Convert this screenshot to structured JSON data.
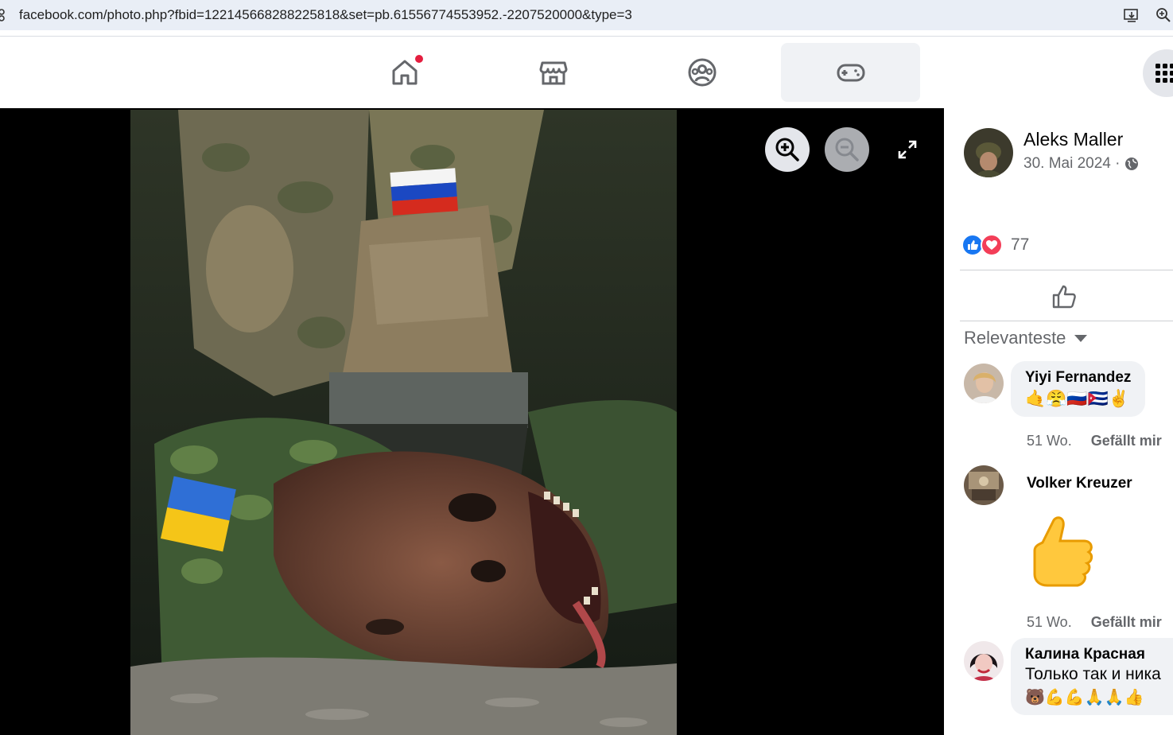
{
  "browser": {
    "url": "facebook.com/photo.php?fbid=122145668288225818&set=pb.61556774553952.-2207520000&type=3"
  },
  "nav": {
    "tabs": [
      {
        "name": "home"
      },
      {
        "name": "marketplace"
      },
      {
        "name": "groups"
      },
      {
        "name": "gaming",
        "active": true
      }
    ]
  },
  "post": {
    "author": "Aleks Maller",
    "date": "30. Mai 2024 ·",
    "reaction_count": "77"
  },
  "comments": {
    "sort_label": "Relevanteste",
    "items": [
      {
        "name": "Yiyi Fernandez",
        "text": "🤙😤🇷🇺🇨🇺✌️",
        "time": "51 Wo.",
        "like": "Gefällt mir"
      },
      {
        "name": "Volker Kreuzer",
        "sticker": "👍",
        "time": "51 Wo.",
        "like": "Gefällt mir"
      },
      {
        "name": "Калина Красная",
        "text": "Только так и ника",
        "emoji_line": "🐻💪💪🙏🙏👍"
      }
    ]
  },
  "colors": {
    "accent": "#1877f2",
    "love": "#f33e58",
    "notification": "#e41e3f"
  }
}
